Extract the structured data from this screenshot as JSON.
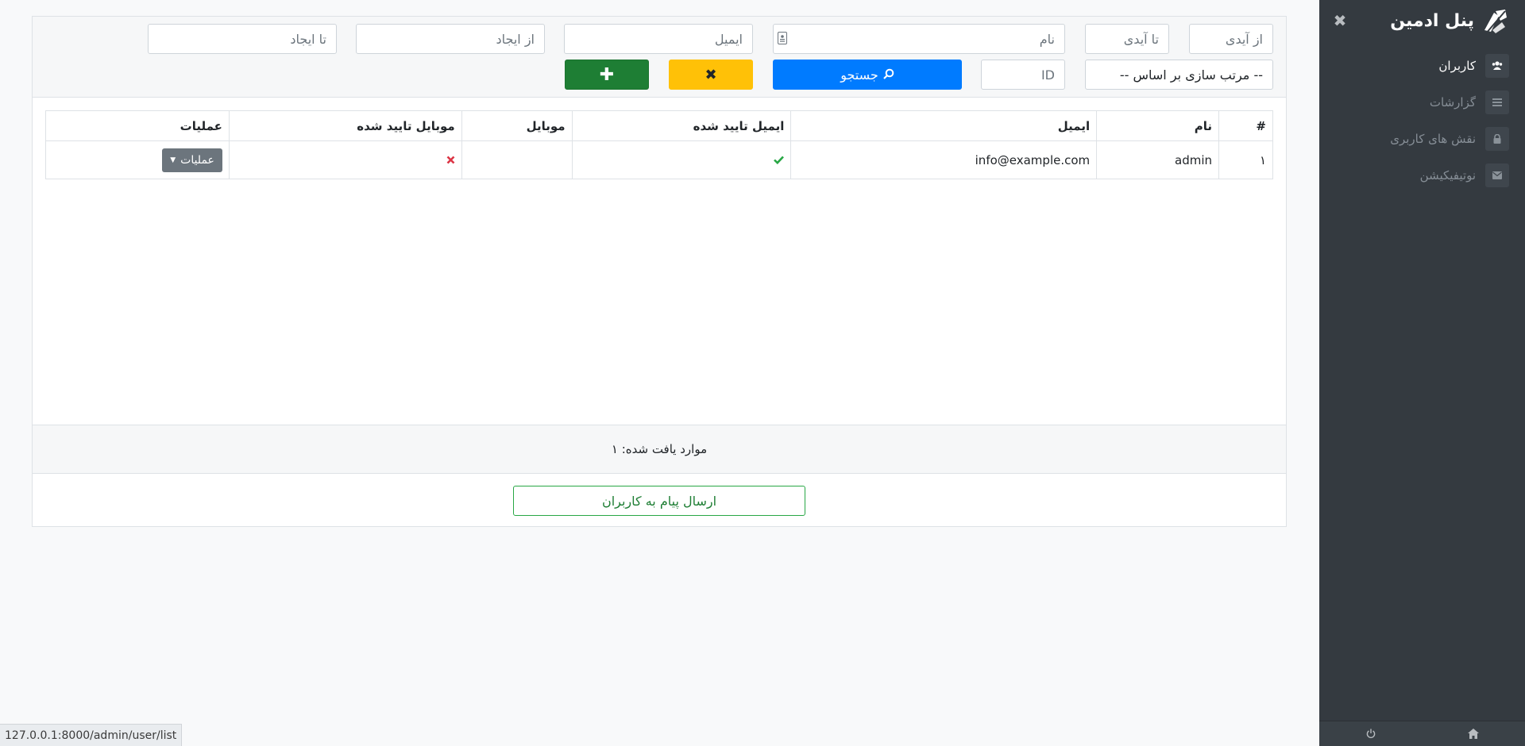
{
  "sidebar": {
    "title": "پنل ادمین",
    "items": [
      {
        "label": "کاربران",
        "icon": "users-icon",
        "active": true
      },
      {
        "label": "گزارشات",
        "icon": "list-icon",
        "active": false
      },
      {
        "label": "نقش های کاربری",
        "icon": "lock-icon",
        "active": false
      },
      {
        "label": "نوتیفیکیشن",
        "icon": "envelope-icon",
        "active": false
      }
    ]
  },
  "filters": {
    "from_id_placeholder": "از آیدی",
    "to_id_placeholder": "تا آیدی",
    "name_placeholder": "نام",
    "email_placeholder": "ایمیل",
    "from_created_placeholder": "از ایجاد",
    "to_created_placeholder": "تا ایجاد",
    "sort_label": "-- مرتب سازی بر اساس --",
    "id_placeholder": "ID",
    "search_label": "جستجو"
  },
  "table": {
    "headers": [
      "#",
      "نام",
      "ایمیل",
      "ایمیل تایید شده",
      "موبایل",
      "موبایل تایید شده",
      "عملیات"
    ],
    "rows": [
      {
        "index": "۱",
        "name": "admin",
        "email": "info@example.com",
        "email_verified": true,
        "mobile": "",
        "mobile_verified": false,
        "ops_label": "عملیات"
      }
    ]
  },
  "footer": {
    "found_text": "موارد یافت شده: ۱",
    "send_message_label": "ارسال پیام به کاربران"
  },
  "status_url": "127.0.0.1:8000/admin/user/list",
  "colors": {
    "sidebar_bg": "#343a40",
    "primary": "#007bff",
    "warning": "#ffc107",
    "success": "#1e7e34",
    "verified_check": "#28a745",
    "unverified_cross": "#dc3545"
  }
}
